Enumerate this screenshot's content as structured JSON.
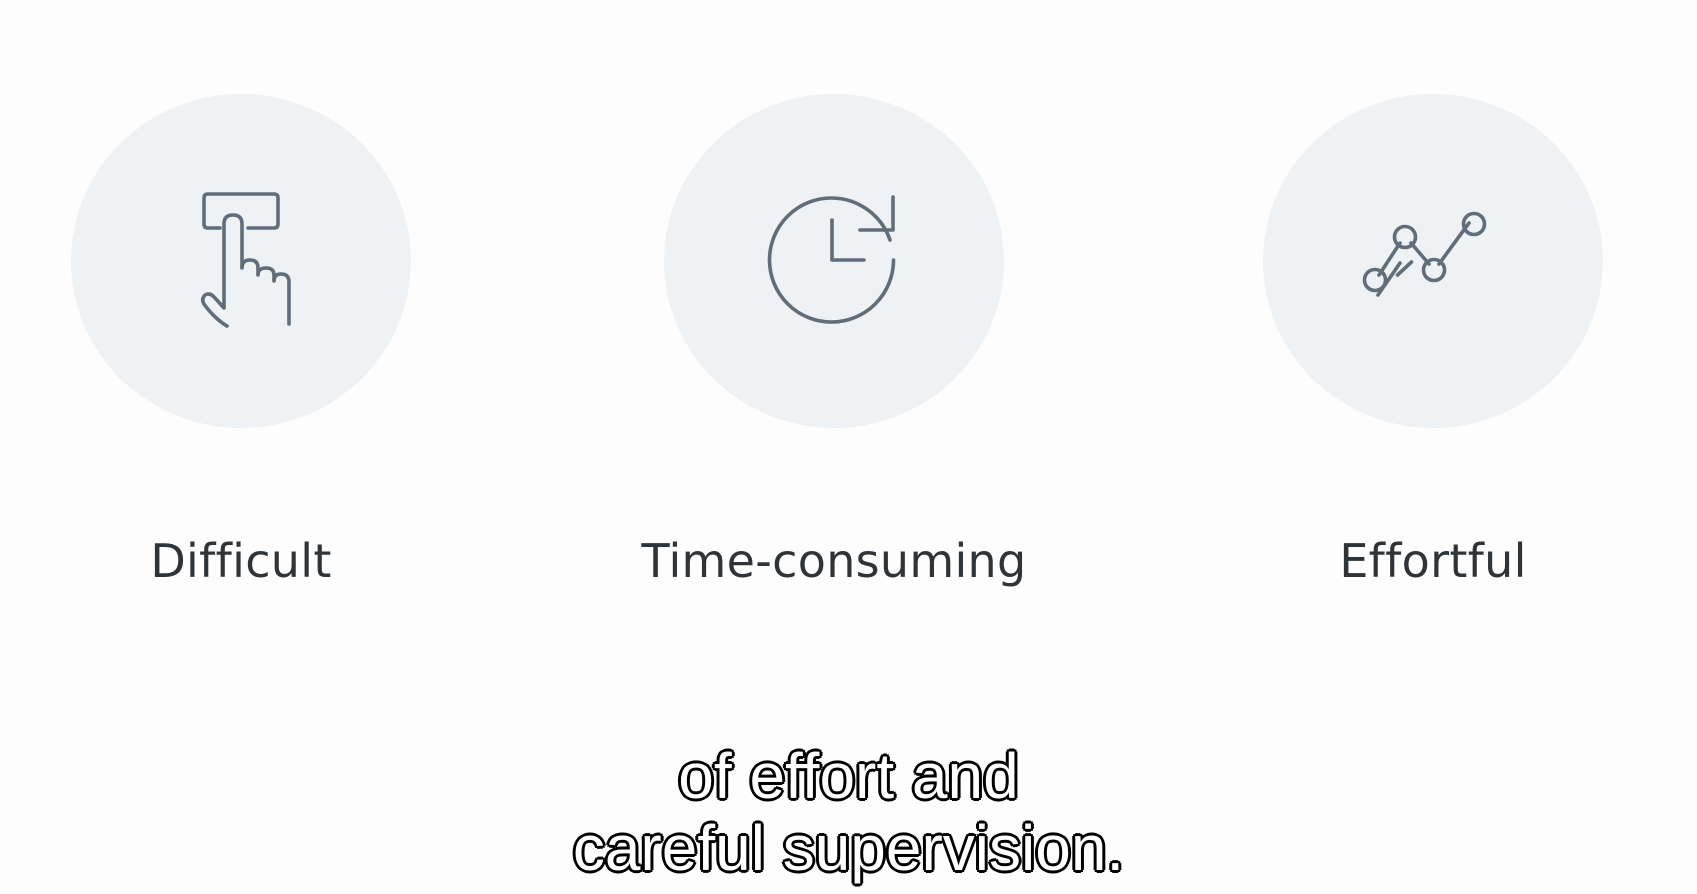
{
  "items": [
    {
      "label": "Difficult",
      "icon": "hand-pointer-icon"
    },
    {
      "label": "Time-consuming",
      "icon": "clock-refresh-icon"
    },
    {
      "label": "Effortful",
      "icon": "line-graph-icon"
    }
  ],
  "caption": {
    "line1": "of effort and",
    "line2": "careful supervision."
  },
  "colors": {
    "background": "#fdfdfd",
    "card": "#eef2f4",
    "icon_stroke": "#616d78",
    "label_text": "#2f3438",
    "caption_fill": "#ffffff",
    "caption_outline": "#000000"
  }
}
